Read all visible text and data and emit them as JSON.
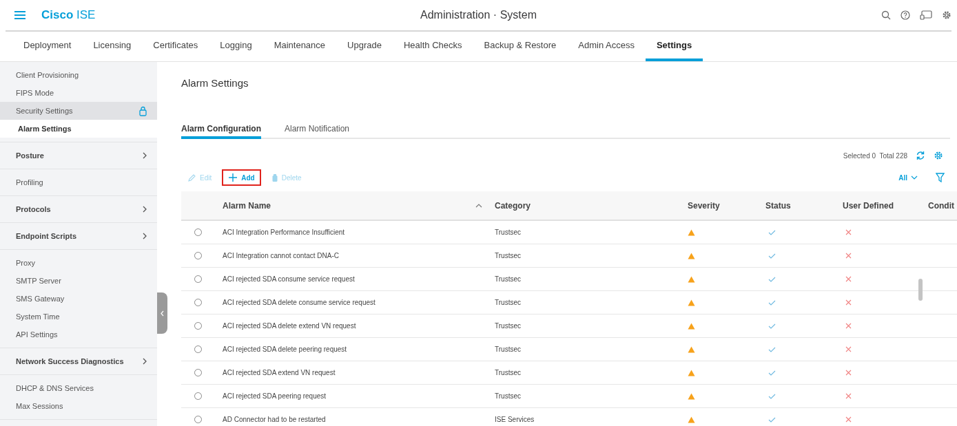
{
  "header": {
    "brand": "**Cisco** ISE",
    "title": "Administration · System"
  },
  "nav_tabs": [
    {
      "label": "Deployment",
      "selected": false
    },
    {
      "label": "Licensing",
      "selected": false
    },
    {
      "label": "Certificates",
      "selected": false
    },
    {
      "label": "Logging",
      "selected": false
    },
    {
      "label": "Maintenance",
      "selected": false
    },
    {
      "label": "Upgrade",
      "selected": false
    },
    {
      "label": "Health Checks",
      "selected": false
    },
    {
      "label": "Backup & Restore",
      "selected": false
    },
    {
      "label": "Admin Access",
      "selected": false
    },
    {
      "label": "Settings",
      "selected": true
    }
  ],
  "sidebar": {
    "sections": [
      {
        "items": [
          {
            "label": "Client Provisioning",
            "kind": "link",
            "selected": false,
            "highlighted": false,
            "locked": false
          },
          {
            "label": "FIPS Mode",
            "kind": "link",
            "selected": false,
            "highlighted": false,
            "locked": false
          },
          {
            "label": "Security Settings",
            "kind": "link",
            "selected": false,
            "highlighted": true,
            "locked": true
          },
          {
            "label": "Alarm Settings",
            "kind": "link",
            "selected": true,
            "highlighted": false,
            "locked": false
          }
        ]
      },
      {
        "items": [
          {
            "label": "Posture",
            "kind": "group",
            "expandable": true
          }
        ]
      },
      {
        "items": [
          {
            "label": "Profiling",
            "kind": "link",
            "selected": false,
            "highlighted": false,
            "locked": false
          }
        ]
      },
      {
        "items": [
          {
            "label": "Protocols",
            "kind": "group",
            "expandable": true
          }
        ]
      },
      {
        "items": [
          {
            "label": "Endpoint Scripts",
            "kind": "group",
            "expandable": true
          }
        ]
      },
      {
        "items": [
          {
            "label": "Proxy",
            "kind": "link",
            "selected": false,
            "highlighted": false,
            "locked": false
          },
          {
            "label": "SMTP Server",
            "kind": "link",
            "selected": false,
            "highlighted": false,
            "locked": false
          },
          {
            "label": "SMS Gateway",
            "kind": "link",
            "selected": false,
            "highlighted": false,
            "locked": false
          },
          {
            "label": "System Time",
            "kind": "link",
            "selected": false,
            "highlighted": false,
            "locked": false
          },
          {
            "label": "API Settings",
            "kind": "link",
            "selected": false,
            "highlighted": false,
            "locked": false
          }
        ]
      },
      {
        "items": [
          {
            "label": "Network Success Diagnostics",
            "kind": "group",
            "expandable": true
          }
        ]
      },
      {
        "items": [
          {
            "label": "DHCP & DNS Services",
            "kind": "link",
            "selected": false,
            "highlighted": false,
            "locked": false
          },
          {
            "label": "Max Sessions",
            "kind": "link",
            "selected": false,
            "highlighted": false,
            "locked": false
          }
        ]
      }
    ]
  },
  "main": {
    "title": "Alarm Settings",
    "tabs": [
      {
        "label": "Alarm Configuration",
        "selected": true
      },
      {
        "label": "Alarm Notification",
        "selected": false
      }
    ],
    "selection_info": "Selected 0  Total 228",
    "actions": [
      {
        "label": "Edit",
        "kind": "edit",
        "disabled": true,
        "highlighted": false
      },
      {
        "label": "Add",
        "kind": "add",
        "disabled": false,
        "highlighted": true
      },
      {
        "label": "Delete",
        "kind": "delete",
        "disabled": true,
        "highlighted": false
      }
    ],
    "view_filter": "All",
    "table": {
      "columns": [
        "Alarm Name",
        "Category",
        "Severity",
        "Status",
        "User Defined",
        "Condit"
      ],
      "rows": [
        {
          "name": "ACI Integration Performance Insufficient",
          "category": "Trustsec",
          "warning": true,
          "status": true,
          "user_defined": false,
          "selected": false
        },
        {
          "name": "ACI Integration cannot contact DNA-C",
          "category": "Trustsec",
          "warning": true,
          "status": true,
          "user_defined": false,
          "selected": false
        },
        {
          "name": "ACI rejected SDA consume service request",
          "category": "Trustsec",
          "warning": true,
          "status": true,
          "user_defined": false,
          "selected": false
        },
        {
          "name": "ACI rejected SDA delete consume service request",
          "category": "Trustsec",
          "warning": true,
          "status": true,
          "user_defined": false,
          "selected": false
        },
        {
          "name": "ACI rejected SDA delete extend VN request",
          "category": "Trustsec",
          "warning": true,
          "status": true,
          "user_defined": false,
          "selected": false
        },
        {
          "name": "ACI rejected SDA delete peering request",
          "category": "Trustsec",
          "warning": true,
          "status": true,
          "user_defined": false,
          "selected": false
        },
        {
          "name": "ACI rejected SDA extend VN request",
          "category": "Trustsec",
          "warning": true,
          "status": true,
          "user_defined": false,
          "selected": false
        },
        {
          "name": "ACI rejected SDA peering request",
          "category": "Trustsec",
          "warning": true,
          "status": true,
          "user_defined": false,
          "selected": false
        },
        {
          "name": "AD Connector had to be restarted",
          "category": "ISE Services",
          "warning": true,
          "status": true,
          "user_defined": false,
          "selected": false
        }
      ]
    }
  }
}
